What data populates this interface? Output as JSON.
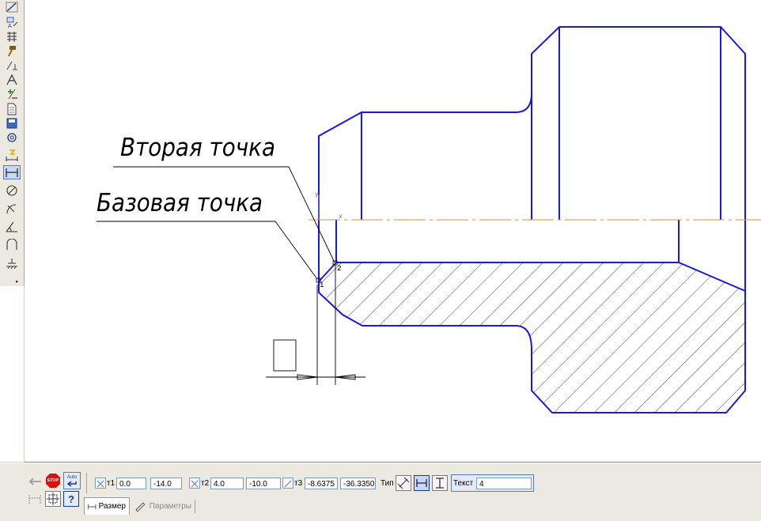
{
  "drawing": {
    "label_second_point": "Вторая точка",
    "label_base_point": "Базовая точка",
    "axis_x": "x",
    "axis_y": "y",
    "point_1": "1",
    "point_2": "2"
  },
  "colors": {
    "contour": "#1a1adf",
    "axis_line": "#f08a3c",
    "hatch": "#1a1a1a",
    "leader": "#000000",
    "accent": "#5a7bb5"
  },
  "toolbar": {
    "icons": [
      "dimension-tool-icon",
      "text-annotation-icon",
      "table-grid-icon",
      "hammer-icon",
      "perpendicular-icon",
      "angle-icon",
      "plus-minus-icon",
      "document-icon",
      "save-box-icon",
      "spiral-icon",
      "linear-dimension-icon",
      "horizontal-dimension-icon",
      "diameter-dimension-icon",
      "radius-dimension-icon",
      "angular-dimension-icon",
      "arc-dimension-icon",
      "roughness-icon"
    ]
  },
  "properties": {
    "stop_label": "STOP",
    "auto_label": "Auto",
    "t1_label": "т1",
    "t1_x": "0.0",
    "t1_y": "-14.0",
    "t2_label": "т2",
    "t2_x": "4.0",
    "t2_y": "-10.0",
    "t3_label": "т3",
    "t3_x": "-8.6375",
    "t3_y": "-36.3350",
    "type_label": "Тип",
    "text_label": "Текст",
    "text_value": "4",
    "tab_size": "Размер",
    "tab_params": "Параметры"
  }
}
